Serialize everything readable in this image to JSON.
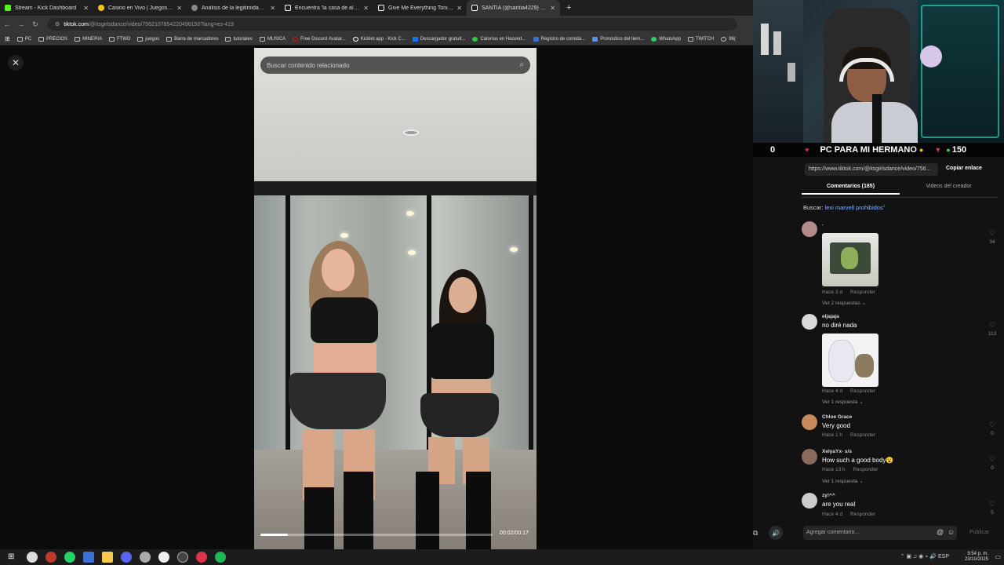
{
  "browser": {
    "tabs": [
      {
        "title": "Stream - Kick Dashboard",
        "color": "#53fc18",
        "active": false
      },
      {
        "title": "Casino en Vivo | Juegos de Casino",
        "color": "#f5c518",
        "active": false
      },
      {
        "title": "Análisis de la legitimidad de M",
        "color": "#aaaaaa",
        "active": false
      },
      {
        "title": "Encuentra 'la casa de alofoke' e",
        "color": "#ffffff",
        "active": false
      },
      {
        "title": "Give Me Everything Tonight - D",
        "color": "#ffffff",
        "active": false
      },
      {
        "title": "SANTIA (@santia4229) | Ti",
        "color": "#ffffff",
        "active": true
      }
    ],
    "new_tab": "+",
    "url_host": "tiktok.com",
    "url_path": "/@itsgirlsdance/video/7562107854220496150?lang=es-419",
    "bookmarks": [
      "PC",
      "PRECIOS",
      "MINERIA",
      "FTWD",
      "juegos",
      "Barra de marcadores",
      "tutoriales",
      "MUSICA",
      "Free Discord Avatar...",
      "Kicklet.app - Kick C...",
      "Descargador gratuit...",
      "Calorías en Hacend...",
      "Registro de comida...",
      "Pronóstico del tiem...",
      "WhatsApp",
      "TWITCH",
      "96("
    ]
  },
  "viewer": {
    "close": "✕",
    "search_placeholder": "Buscar contenido relacionado",
    "search_icon": "⌕",
    "progress_fraction": 0.118,
    "timecode": "00:02/00:17",
    "nav_up": "⌃",
    "nav_down": "⌄",
    "volume_icon": "🔊"
  },
  "stream": {
    "counter": "0",
    "title": "PC PARA MI HERMANO",
    "viewers": "150"
  },
  "comments_panel": {
    "link": "https://www.tiktok.com/@itsgirlsdance/video/756...",
    "copy_link": "Copiar enlace",
    "tab_comments": "Comentarios (185)",
    "tab_videos": "Videos del creador",
    "search_prefix": "Buscar:",
    "search_keyword": "lexi marvell prohibidos",
    "comments": [
      {
        "user": ".",
        "text": "",
        "meta_time": "Hace 3 d",
        "meta_reply": "Responder",
        "replies": "Ver 2 respuestas ⌄",
        "likes": "34",
        "avatar_color": "#b38a8a"
      },
      {
        "user": "eljajaja",
        "text": "no diré nada",
        "meta_time": "Hace 4 d",
        "meta_reply": "Responder",
        "replies": "Ver 1 respuesta ⌄",
        "likes": "113",
        "avatar_color": "#d9d9d9"
      },
      {
        "user": "Chloe Grace",
        "text": "Very good",
        "meta_time": "Hace 1 h",
        "meta_reply": "Responder",
        "replies": "",
        "likes": "0",
        "avatar_color": "#c88a5a"
      },
      {
        "user": "XelyaYx- s/s",
        "text": "How such a good body😮",
        "meta_time": "Hace 13 h",
        "meta_reply": "Responder",
        "replies": "Ver 1 respuesta ⌄",
        "likes": "0",
        "avatar_color": "#8a6a5a"
      },
      {
        "user": "zy!^^",
        "text": "are you real",
        "meta_time": "Hace 4 d",
        "meta_reply": "Responder",
        "replies": "",
        "likes": "5",
        "avatar_color": "#cccccc"
      }
    ],
    "add_comment": "Agregar comentario...",
    "at_icon": "@",
    "emoji_icon": "☺",
    "publish": "Publicar"
  },
  "taskbar": {
    "time": "9:54 p. m.",
    "date": "23/10/2025",
    "lang": "ESP"
  }
}
